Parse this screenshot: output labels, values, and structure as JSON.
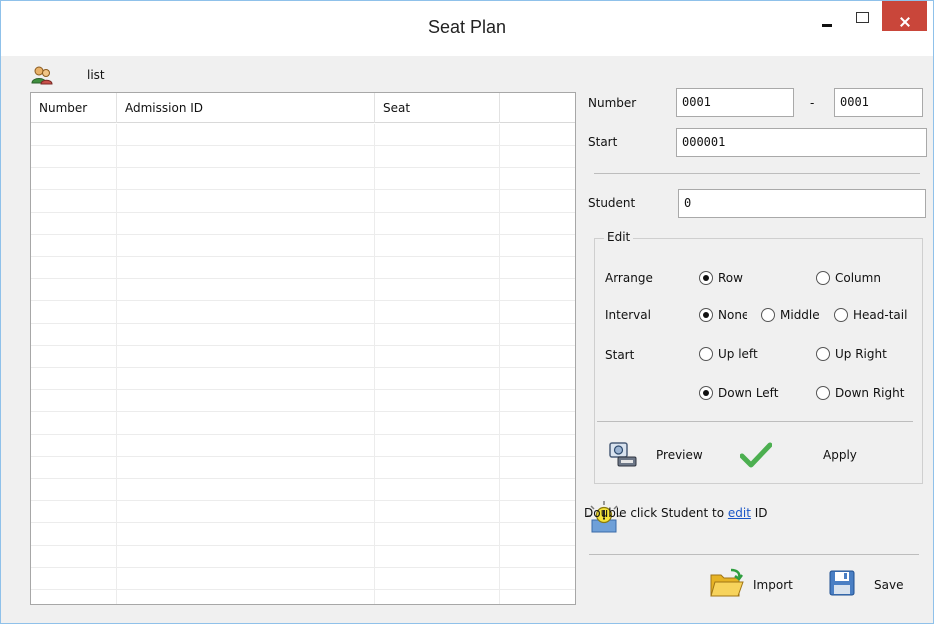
{
  "window": {
    "title": "Seat Plan"
  },
  "list": {
    "label": "list",
    "columns": [
      "Number",
      "Admission ID",
      "Seat",
      ""
    ],
    "row_count": 22
  },
  "form": {
    "number_label": "Number",
    "number_from": "0001",
    "number_separator": "-",
    "number_to": "0001",
    "start_label": "Start",
    "start_value": "000001",
    "student_label": "Student",
    "student_value": "0"
  },
  "edit": {
    "title": "Edit",
    "arrange_label": "Arrange",
    "arrange_options": [
      "Row",
      "Column"
    ],
    "arrange_selected": "Row",
    "interval_label": "Interval",
    "interval_options": [
      "None",
      "Middle",
      "Head-tail"
    ],
    "interval_selected": "None",
    "start_label": "Start",
    "start_options": [
      "Up left",
      "Up Right",
      "Down Left",
      "Down Right"
    ],
    "start_selected": "Down Left",
    "preview_label": "Preview",
    "apply_label": "Apply"
  },
  "hint": {
    "prefix": "Double click Student to ",
    "link": "edit",
    "suffix": " ID"
  },
  "footer": {
    "import_label": "Import",
    "save_label": "Save"
  },
  "colors": {
    "close_button": "#c9463a",
    "link": "#1a56c7",
    "check": "#4caf50",
    "window_border": "#8fc1ea"
  },
  "icons": {
    "list": "users-icon",
    "preview": "preview-icon",
    "apply": "check-icon",
    "hint": "lightbulb-icon",
    "import": "folder-open-icon",
    "save": "floppy-disk-icon"
  }
}
